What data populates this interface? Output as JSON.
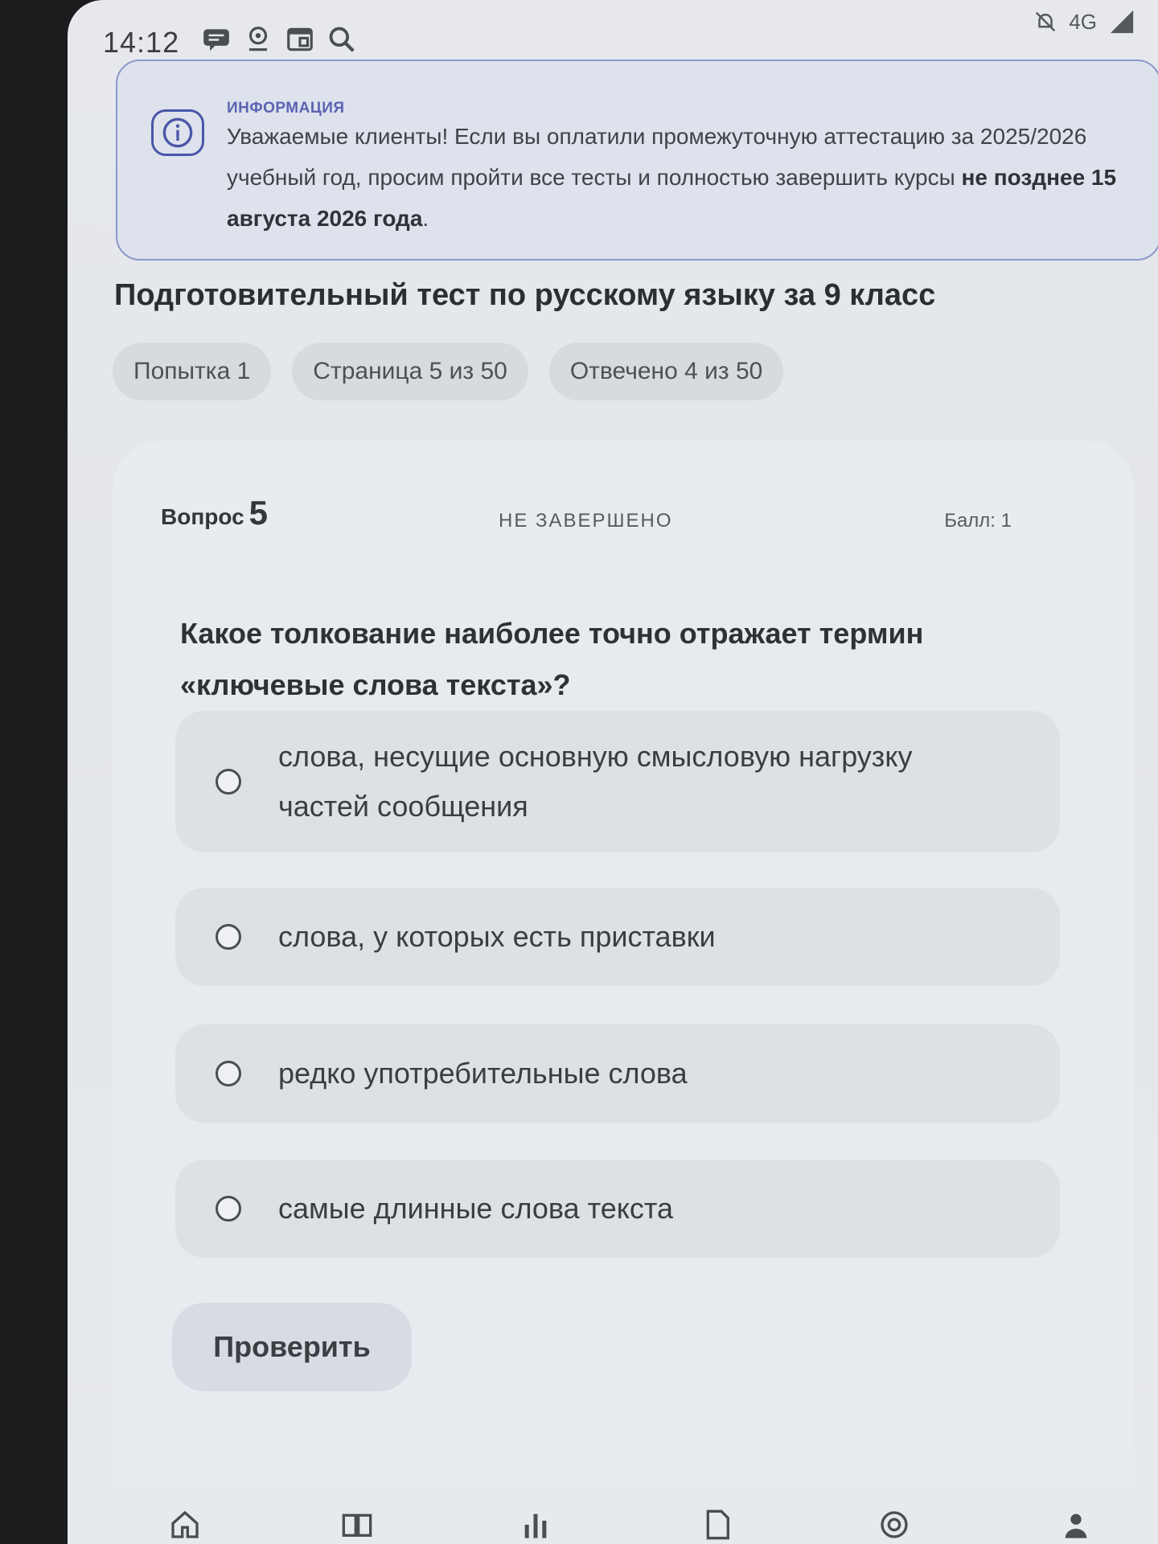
{
  "status_bar": {
    "time": "14:12",
    "network": "4G",
    "icons": [
      "chat-icon",
      "location-icon",
      "calendar-icon",
      "search-icon"
    ],
    "right_icons": [
      "mute-icon",
      "signal-icon"
    ]
  },
  "info_banner": {
    "title": "ИНФОРМАЦИЯ",
    "text_before": "Уважаемые клиенты! Если вы оплатили промежуточную аттестацию за 2025/2026 учебный год, просим пройти все тесты и полностью завершить курсы ",
    "text_bold": "не позднее 15 августа 2026 года",
    "text_after": ".",
    "accent_color": "#4a56a8"
  },
  "test": {
    "title": "Подготовительный тест по русскому языку за 9 класс",
    "chips": {
      "attempt": "Попытка 1",
      "page": "Страница 5 из 50",
      "answered": "Отвечено 4 из 50"
    }
  },
  "question": {
    "label": "Вопрос",
    "number": "5",
    "state": "НЕ ЗАВЕРШЕНО",
    "score": "Балл: 1",
    "text": "Какое толкование наиболее точно отражает термин «ключевые слова текста»?",
    "options": [
      "слова, несущие основную смысловую нагрузку частей сообщения",
      "слова, у которых есть приставки",
      "редко употребительные слова",
      "самые длинные слова текста"
    ],
    "check_label": "Проверить"
  },
  "bottom_nav": {
    "items": [
      "home-icon",
      "book-icon",
      "stats-icon",
      "document-icon",
      "help-icon",
      "profile-icon"
    ]
  }
}
